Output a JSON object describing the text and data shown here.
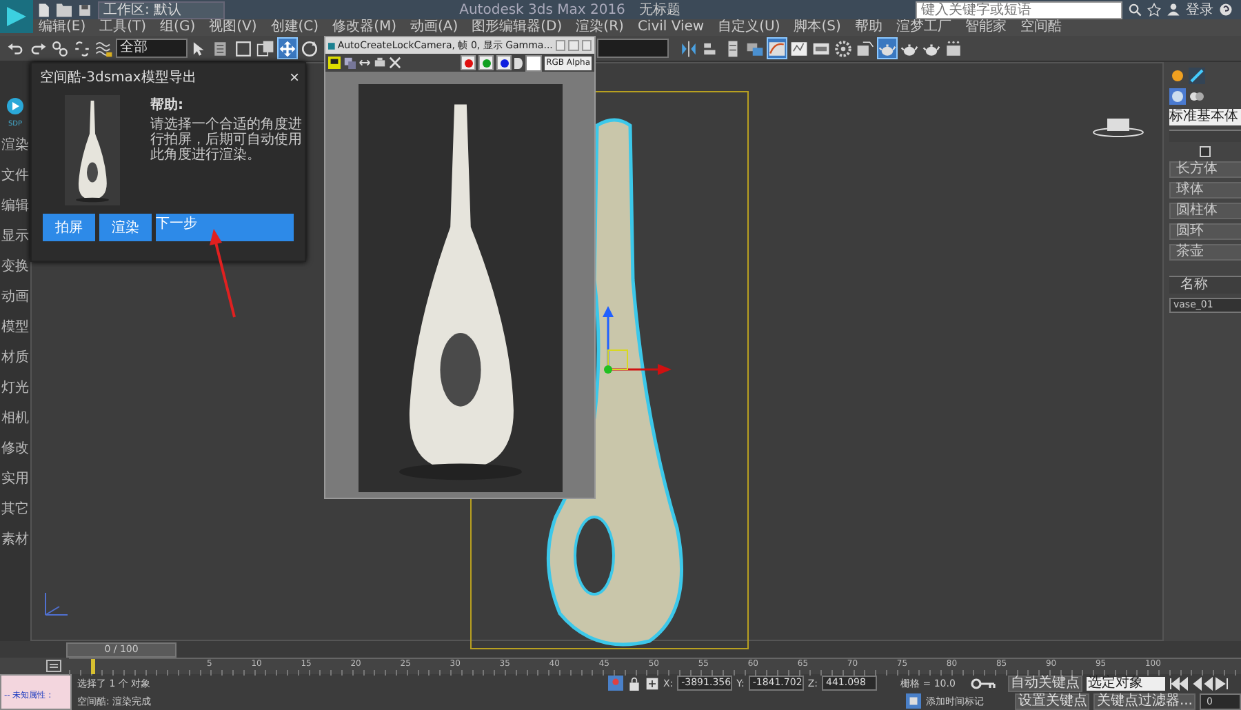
{
  "title_bar": {
    "workspace": "工作区: 默认",
    "app_title": "Autodesk 3ds Max 2016",
    "document": "无标题",
    "search": {
      "placeholder": "键入关键字或短语"
    },
    "sign_in": "登录"
  },
  "menu": [
    "编辑(E)",
    "工具(T)",
    "组(G)",
    "视图(V)",
    "创建(C)",
    "修改器(M)",
    "动画(A)",
    "图形编辑器(D)",
    "渲染(R)",
    "Civil View",
    "自定义(U)",
    "脚本(S)",
    "帮助",
    "渲梦工厂",
    "智能家",
    "空间酷"
  ],
  "toolbar": {
    "selection_filter": "全部",
    "buttons": [
      {
        "kind": "undo",
        "selected": false
      },
      {
        "kind": "redo",
        "selected": false
      },
      {
        "kind": "link",
        "selected": false
      },
      {
        "kind": "unlink",
        "selected": false
      },
      {
        "kind": "bind",
        "selected": false
      },
      {
        "kind": "filter",
        "selected": false
      },
      {
        "kind": "select",
        "selected": false
      },
      {
        "kind": "rect",
        "selected": false
      },
      {
        "kind": "window",
        "selected": false
      },
      {
        "kind": "move",
        "selected": true
      },
      {
        "kind": "rotate",
        "selected": false
      },
      {
        "kind": "mirror",
        "selected": false
      },
      {
        "kind": "align",
        "selected": false
      },
      {
        "kind": "layers",
        "selected": false
      },
      {
        "kind": "ribbon",
        "selected": false
      },
      {
        "kind": "curve",
        "selected": true
      },
      {
        "kind": "schematic",
        "selected": false
      },
      {
        "kind": "material",
        "selected": false
      },
      {
        "kind": "render-setup",
        "selected": false
      },
      {
        "kind": "frame",
        "selected": false
      },
      {
        "kind": "teapot",
        "selected": true
      },
      {
        "kind": "teapot",
        "selected": false
      },
      {
        "kind": "teapot",
        "selected": false
      },
      {
        "kind": "more",
        "selected": false
      }
    ]
  },
  "sidebar": {
    "logo": "SDP",
    "items": [
      "渲染",
      "文件",
      "编辑",
      "显示",
      "变换",
      "动画",
      "模型",
      "材质",
      "灯光",
      "相机",
      "修改",
      "实用",
      "其它",
      "素材"
    ]
  },
  "export_dialog": {
    "title": "空间酷-3dsmax模型导出",
    "close": "×",
    "help_title": "帮助:",
    "help_text": "请选择一个合适的角度进行拍屏，后期可自动使用此角度进行渲染。",
    "buttons": [
      "拍屏",
      "渲染",
      "下一步"
    ]
  },
  "render_window": {
    "title": "AutoCreateLockCamera, 帧 0, 显示 Gamma...",
    "channels": [
      {
        "color": "#e01010"
      },
      {
        "color": "#10a020"
      },
      {
        "color": "#1020e0"
      }
    ],
    "channel_display": "RGB Alpha"
  },
  "command_panel": {
    "category": "标准基本体",
    "auto_grid": {
      "checked": false
    },
    "object_types": [
      "长方体",
      "球体",
      "圆柱体",
      "圆环",
      "茶壶"
    ],
    "name_header": "名称",
    "name": "vase_01"
  },
  "timeline": {
    "position": "0 / 100",
    "ticks": [
      "5",
      "10",
      "15",
      "20",
      "25",
      "30",
      "35",
      "40",
      "45",
      "50",
      "55",
      "60",
      "65",
      "70",
      "75",
      "80",
      "85",
      "90",
      "95",
      "100"
    ]
  },
  "status": {
    "listener": "-- 未知属性 :",
    "selection": "选择了 1 个 对象",
    "prompt": "空间酷: 渲染完成",
    "coords": [
      {
        "label": "X:",
        "value": "-3891.356"
      },
      {
        "label": "Y:",
        "value": "-1841.702"
      },
      {
        "label": "Z:",
        "value": "441.098"
      }
    ],
    "grid": "栅格 = 10.0",
    "add_time_tag": "添加时间标记",
    "auto_key": "自动关键点",
    "key_target": "选定对象",
    "set_key": "设置关键点",
    "key_filters": "关键点过滤器...",
    "frame": "0"
  }
}
